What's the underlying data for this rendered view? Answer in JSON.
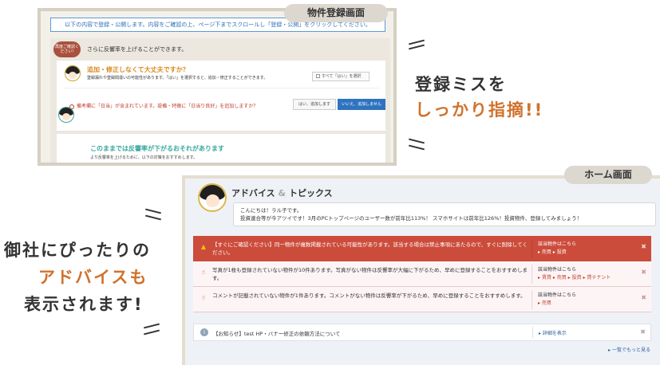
{
  "registration_screen": {
    "tag": "物件登録画面",
    "notice": "以下の内容で登録・公開します。内容をご確認の上、ページ下までスクロールし「登録・公開」をクリックしてください。",
    "bubble": "再度ご確認ください!",
    "panel_title": "さらに反響率を上げることができます。",
    "check_title": "追加・修正しなくて大丈夫ですか？",
    "check_sub": "登録漏れや登録間違いの可能性があります。「はい」を選択すると、追加・修正することができます。",
    "check_all": "すべて「はい」を選択",
    "warn_text": "備考欄に「日当」が含まれています。設備・特徴に「日当り良好」を追加しますか？",
    "btn_yes": "はい、追加します",
    "btn_no": "いいえ、追加しません",
    "drop_title": "このままでは反響率が下がるおそれがあります",
    "drop_sub": "より反響率を上げるために、以下の対策をおすすめします。"
  },
  "caption1": {
    "line1": "登録ミスを",
    "line2": "しっかり指摘!!"
  },
  "caption2": {
    "line1": "御社にぴったりの",
    "line2": "アドバイスも",
    "line3": "表示されます!"
  },
  "home_screen": {
    "tag": "ホーム画面",
    "title_part1": "アドバイス",
    "title_amp": "&",
    "title_part2": "トピックス",
    "greeting": "こんにちは！ラル子です。",
    "message": "投資連合等が今アツイです！3月のPCトップページのユーザー数が前年比113%！ スマホサイトは前年比126%！投資物件、登録してみましょう！",
    "alerts": [
      {
        "icon": "warning-icon",
        "text": "【すぐにご確認ください】同一物件が複数掲載されている可能性があります。該当する場合は禁止事項にあたるので、すぐに削除してください。",
        "side_label": "該当物件はこちら",
        "side_links": "▸ 売買 ▸ 投資"
      },
      {
        "icon": "pointer-icon",
        "text": "写真が1枚も登録されていない物件が10件あります。写真がない物件は反響率が大幅に下がるため、早めに登録することをおすすめします。",
        "side_label": "該当物件はこちら",
        "side_links": "▸ 賃貸 ▸ 売買 ▸ 投資 ▸ 貸テナント"
      },
      {
        "icon": "pointer-icon",
        "text": "コメントが記載されていない物件が1件あります。コメントがない物件は反響率が下がるため、早めに登録することをおすすめします。",
        "side_label": "該当物件はこちら",
        "side_links": "▸ 売買"
      }
    ],
    "info_text": "【お知らせ】test HP・バナー修正の依頼方法について",
    "info_link": "▸ 詳細を表示",
    "more_link": "▸ 一覧でもっと見る",
    "close_glyph": "✖"
  }
}
